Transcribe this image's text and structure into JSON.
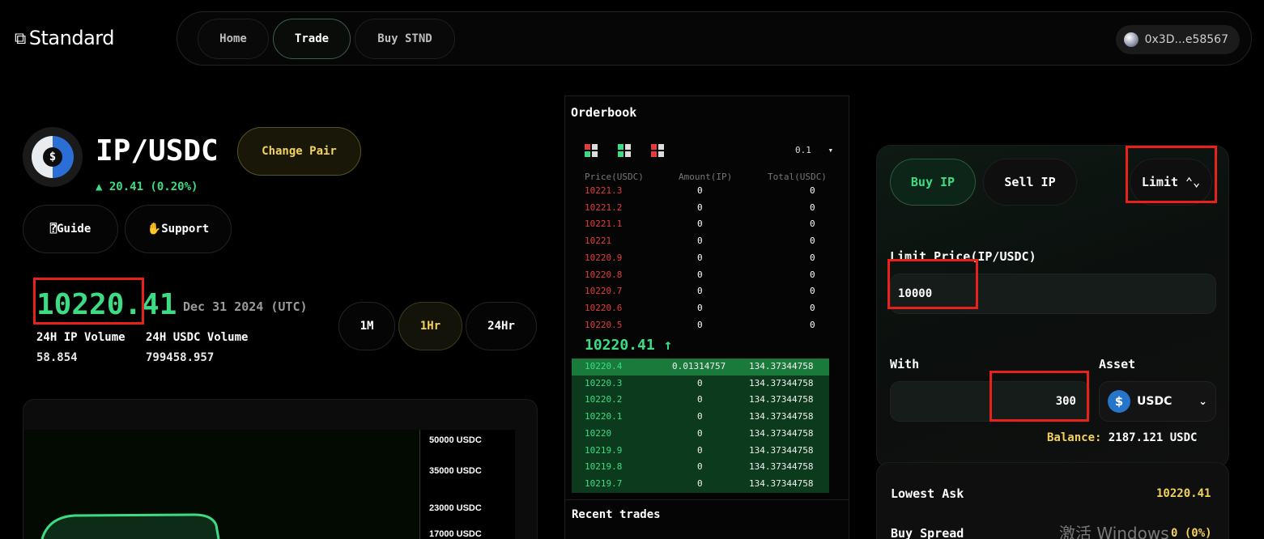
{
  "brand": {
    "name": "Standard",
    "icon": "asterisk-link-icon"
  },
  "nav": {
    "home": "Home",
    "trade": "Trade",
    "buy_stnd": "Buy STND",
    "active": "Trade"
  },
  "wallet": {
    "address": "0x3D...e58567"
  },
  "pair": {
    "title": "IP/USDC",
    "change_button": "Change Pair",
    "change": "▲ 20.41 (0.20%)",
    "guide": "⍰Guide",
    "support": "✋Support"
  },
  "market": {
    "price": "10220.41",
    "date": "Dec 31 2024 (UTC)",
    "vol_ip_label": "24H IP Volume",
    "vol_ip_value": "58.854",
    "vol_usdc_label": "24H USDC Volume",
    "vol_usdc_value": "799458.957",
    "timeframes": [
      "1M",
      "1Hr",
      "24Hr"
    ],
    "active_timeframe": "1Hr"
  },
  "chart": {
    "y_ticks": [
      "50000 USDC",
      "35000 USDC",
      "23000 USDC",
      "17000 USDC"
    ],
    "line_color": "#3ddc84"
  },
  "orderbook": {
    "title": "Orderbook",
    "decimals": "0.1",
    "headers": [
      "Price(USDC)",
      "Amount(IP)",
      "Total(USDC)"
    ],
    "asks": [
      [
        "10221.3",
        "0",
        "0"
      ],
      [
        "10221.2",
        "0",
        "0"
      ],
      [
        "10221.1",
        "0",
        "0"
      ],
      [
        "10221",
        "0",
        "0"
      ],
      [
        "10220.9",
        "0",
        "0"
      ],
      [
        "10220.8",
        "0",
        "0"
      ],
      [
        "10220.7",
        "0",
        "0"
      ],
      [
        "10220.6",
        "0",
        "0"
      ],
      [
        "10220.5",
        "0",
        "0"
      ]
    ],
    "last_price": "10220.41 ↑",
    "bids": [
      [
        "10220.4",
        "0.01314757",
        "134.37344758"
      ],
      [
        "10220.3",
        "0",
        "134.37344758"
      ],
      [
        "10220.2",
        "0",
        "134.37344758"
      ],
      [
        "10220.1",
        "0",
        "134.37344758"
      ],
      [
        "10220",
        "0",
        "134.37344758"
      ],
      [
        "10219.9",
        "0",
        "134.37344758"
      ],
      [
        "10219.8",
        "0",
        "134.37344758"
      ],
      [
        "10219.7",
        "0",
        "134.37344758"
      ]
    ],
    "recent_title": "Recent trades"
  },
  "trade": {
    "buy_tab": "Buy IP",
    "sell_tab": "Sell IP",
    "order_type": "Limit ⌃⌄",
    "limit_label": "Limit Price(IP/USDC)",
    "limit_value": "10000",
    "with_label": "With",
    "with_value": "300",
    "asset_label": "Asset",
    "asset_value": "USDC",
    "balance_label": "Balance:",
    "balance_value": "2187.121 USDC",
    "lowest_ask_label": "Lowest Ask",
    "lowest_ask_value": "10220.41",
    "buy_spread_label": "Buy Spread",
    "buy_spread_value": "0 (0%)"
  },
  "watermark": "激活 Windows",
  "colors": {
    "green": "#3ddc84",
    "red": "#e53b3b",
    "gold": "#f3d25a",
    "highlight": "#e8221a"
  }
}
